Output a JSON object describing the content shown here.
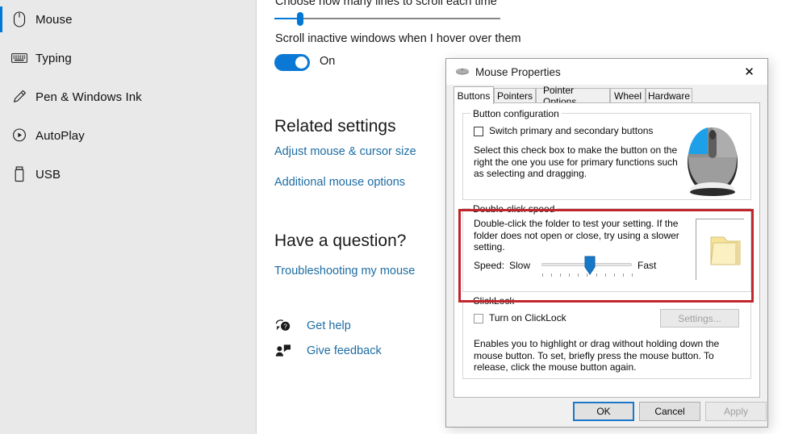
{
  "sidebar": {
    "items": [
      {
        "label": "Mouse",
        "icon": "mouse-icon",
        "selected": true
      },
      {
        "label": "Typing",
        "icon": "keyboard-icon",
        "selected": false
      },
      {
        "label": "Pen & Windows Ink",
        "icon": "pen-icon",
        "selected": false
      },
      {
        "label": "AutoPlay",
        "icon": "autoplay-icon",
        "selected": false
      },
      {
        "label": "USB",
        "icon": "usb-icon",
        "selected": false
      }
    ]
  },
  "main": {
    "scroll_lines_label": "Choose how many lines to scroll each time",
    "scroll_inactive_label": "Scroll inactive windows when I hover over them",
    "toggle_state": "On",
    "related_settings_heading": "Related settings",
    "related_links": [
      "Adjust mouse & cursor size",
      "Additional mouse options"
    ],
    "question_heading": "Have a question?",
    "question_link": "Troubleshooting my mouse",
    "help_rows": [
      {
        "label": "Get help",
        "icon": "get-help-icon"
      },
      {
        "label": "Give feedback",
        "icon": "give-feedback-icon"
      }
    ]
  },
  "dialog": {
    "title": "Mouse Properties",
    "title_icon": "mouse-icon",
    "close_label": "✕",
    "tabs": [
      {
        "label": "Buttons",
        "active": true
      },
      {
        "label": "Pointers",
        "active": false
      },
      {
        "label": "Pointer Options",
        "active": false
      },
      {
        "label": "Wheel",
        "active": false
      },
      {
        "label": "Hardware",
        "active": false
      }
    ],
    "button_config": {
      "legend": "Button configuration",
      "checkbox_label": "Switch primary and secondary buttons",
      "checked": false,
      "description": "Select this check box to make the button on the right the one you use for primary functions such as selecting and dragging."
    },
    "double_click": {
      "legend": "Double-click speed",
      "description": "Double-click the folder to test your setting. If the folder does not open or close, try using a slower setting.",
      "speed_label": "Speed:",
      "slow_label": "Slow",
      "fast_label": "Fast",
      "slider_percent": 58,
      "tick_count": 11
    },
    "click_lock": {
      "legend": "ClickLock",
      "checkbox_label": "Turn on ClickLock",
      "checked": false,
      "settings_button": "Settings...",
      "settings_disabled": true,
      "description": "Enables you to highlight or drag without holding down the mouse button. To set, briefly press the mouse button. To release, click the mouse button again."
    },
    "footer_buttons": [
      {
        "label": "OK",
        "style": "default"
      },
      {
        "label": "Cancel",
        "style": "normal"
      },
      {
        "label": "Apply",
        "style": "disabled"
      }
    ]
  },
  "annotation": {
    "highlight_color": "#c0272d",
    "highlight_target": "double-click-speed-group"
  }
}
